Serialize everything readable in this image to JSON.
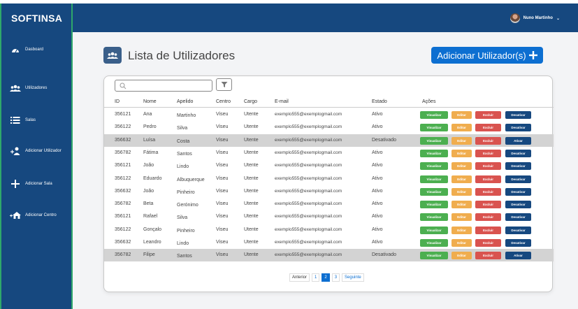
{
  "brand": "SOFTINSA",
  "sidebar": {
    "items": [
      {
        "label": "Dasboard",
        "icon": "dashboard-icon"
      },
      {
        "label": "Utilizadores",
        "icon": "users-icon"
      },
      {
        "label": "Salas",
        "icon": "list-icon"
      },
      {
        "label": "Adicionar Utilizador",
        "icon": "add-user-icon"
      },
      {
        "label": "Adicionar Sala",
        "icon": "plus-icon"
      },
      {
        "label": "Adicionar Centro",
        "icon": "add-building-icon"
      }
    ]
  },
  "header": {
    "user_name": "Nuno Martinho",
    "caret": "⌄"
  },
  "main": {
    "title": "Lista de Utilizadores",
    "add_button": "Adicionar Utilizador(s)",
    "search": {
      "placeholder": ""
    },
    "columns": [
      "ID",
      "Nome",
      "Apelido",
      "Centro",
      "Cargo",
      "E-mail",
      "Estado",
      "Ações"
    ],
    "rows": [
      {
        "id": "356121",
        "nome": "Ana",
        "apelido": "Martinho",
        "centro": "Viseu",
        "cargo": "Utente",
        "email": "exemplo555@exemplogmail.com",
        "estado": "Ativo",
        "action": "Desativar"
      },
      {
        "id": "356122",
        "nome": "Pedro",
        "apelido": "Silva",
        "centro": "Viseu",
        "cargo": "Utente",
        "email": "exemplo555@exemplogmail.com",
        "estado": "Ativo",
        "action": "Desativar"
      },
      {
        "id": "356632",
        "nome": "Luísa",
        "apelido": "Costa",
        "centro": "Viseu",
        "cargo": "Utente",
        "email": "exemplo555@exemplogmail.com",
        "estado": "Desativado",
        "action": "Ativar"
      },
      {
        "id": "356782",
        "nome": "Fátima",
        "apelido": "Santos",
        "centro": "Viseu",
        "cargo": "Utente",
        "email": "exemplo555@exemplogmail.com",
        "estado": "Ativo",
        "action": "Desativar"
      },
      {
        "id": "356121",
        "nome": "João",
        "apelido": "Lindo",
        "centro": "Viseu",
        "cargo": "Utente",
        "email": "exemplo555@exemplogmail.com",
        "estado": "Ativo",
        "action": "Desativar"
      },
      {
        "id": "356122",
        "nome": "Eduardo",
        "apelido": "Albuquerque",
        "centro": "Viseu",
        "cargo": "Utente",
        "email": "exemplo555@exemplogmail.com",
        "estado": "Ativo",
        "action": "Desativar"
      },
      {
        "id": "356632",
        "nome": "João",
        "apelido": "Pinheiro",
        "centro": "Viseu",
        "cargo": "Utente",
        "email": "exemplo555@exemplogmail.com",
        "estado": "Ativo",
        "action": "Desativar"
      },
      {
        "id": "356782",
        "nome": "Beta",
        "apelido": "Gerónimo",
        "centro": "Viseu",
        "cargo": "Utente",
        "email": "exemplo555@exemplogmail.com",
        "estado": "Ativo",
        "action": "Desativar"
      },
      {
        "id": "356121",
        "nome": "Rafael",
        "apelido": "Silva",
        "centro": "Viseu",
        "cargo": "Utente",
        "email": "exemplo555@exemplogmail.com",
        "estado": "Ativo",
        "action": "Desativar"
      },
      {
        "id": "356122",
        "nome": "Gonçalo",
        "apelido": "Pinheiro",
        "centro": "Viseu",
        "cargo": "Utente",
        "email": "exemplo555@exemplogmail.com",
        "estado": "Ativo",
        "action": "Desativar"
      },
      {
        "id": "356632",
        "nome": "Leandro",
        "apelido": "Lindo",
        "centro": "Viseu",
        "cargo": "Utente",
        "email": "exemplo555@exemplogmail.com",
        "estado": "Ativo",
        "action": "Desativar"
      },
      {
        "id": "356782",
        "nome": "Filipe",
        "apelido": "Santos",
        "centro": "Viseu",
        "cargo": "Utente",
        "email": "exemplo555@exemplogmail.com",
        "estado": "Desativado",
        "action": "Ativar"
      }
    ],
    "actions": {
      "view": "Visualizar",
      "edit": "Editar",
      "delete": "Excluir"
    },
    "pagination": {
      "prev": "Anterior",
      "pages": [
        "1",
        "2",
        "3"
      ],
      "current": "2",
      "next": "Seguinte"
    }
  },
  "colors": {
    "primary": "#16487f",
    "accent": "#0d6fd1",
    "view": "#4caf50",
    "edit": "#f0ad4e",
    "delete": "#d9534f"
  }
}
